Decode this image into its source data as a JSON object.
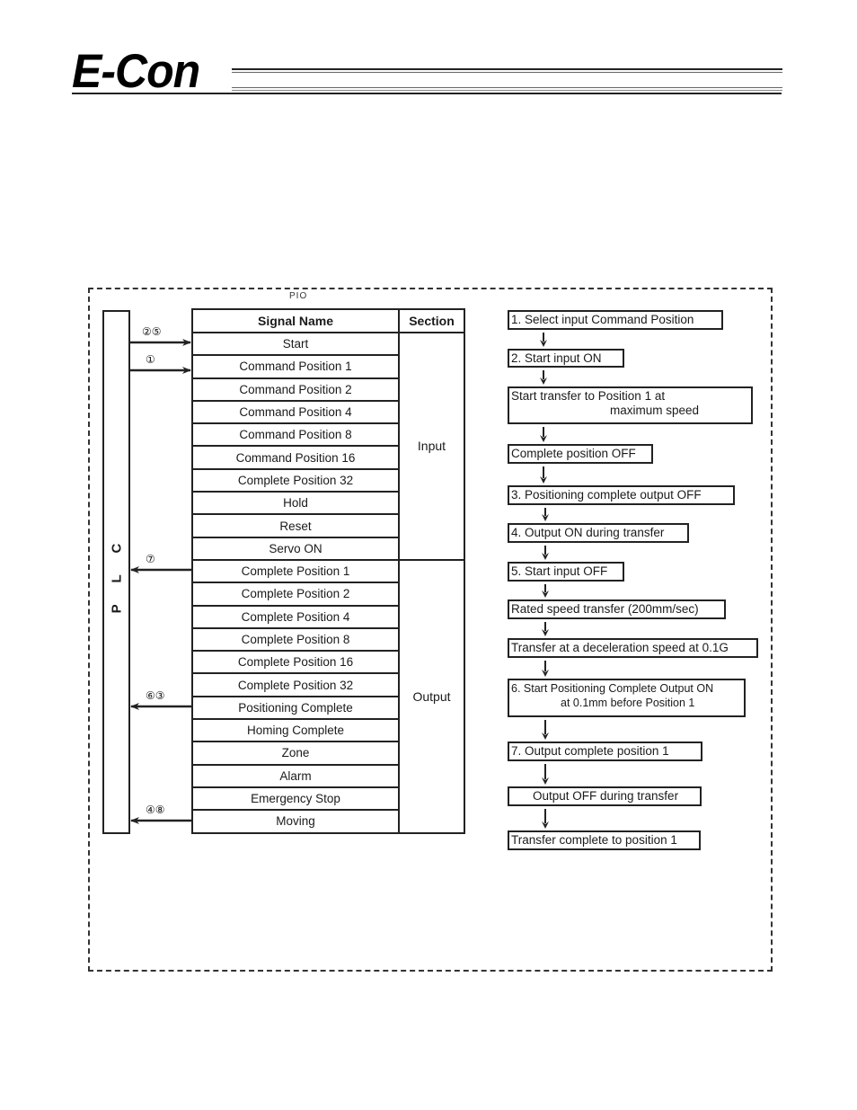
{
  "header": {
    "logo_text": "E-Con"
  },
  "diagram": {
    "pio_label": "PIO",
    "plc_label": "P L C",
    "table": {
      "headers": {
        "signal_name": "Signal Name",
        "section": "Section"
      },
      "input_section_label": "Input",
      "output_section_label": "Output",
      "input_signals": [
        "Start",
        "Command Position 1",
        "Command Position 2",
        "Command Position 4",
        "Command Position 8",
        "Command Position 16",
        "Complete Position 32",
        "Hold",
        "Reset",
        "Servo ON"
      ],
      "output_signals": [
        "Complete Position 1",
        "Complete Position 2",
        "Complete Position 4",
        "Complete Position 8",
        "Complete Position 16",
        "Complete Position 32",
        "Positioning Complete",
        "Homing Complete",
        "Zone",
        "Alarm",
        "Emergency Stop",
        "Moving"
      ]
    },
    "connections": [
      {
        "label": "②⑤",
        "signal": "Start",
        "direction": "to-pio"
      },
      {
        "label": "①",
        "signal": "Command Position 1",
        "direction": "to-pio"
      },
      {
        "label": "⑦",
        "signal": "Complete Position 1",
        "direction": "to-plc"
      },
      {
        "label": "⑥③",
        "signal": "Positioning Complete",
        "direction": "to-plc"
      },
      {
        "label": "④⑧",
        "signal": "Moving",
        "direction": "to-plc"
      }
    ],
    "flow_steps": [
      {
        "line1": "1. Select input Command Position",
        "line2": ""
      },
      {
        "line1": "2. Start input ON",
        "line2": ""
      },
      {
        "line1": "Start transfer to Position 1 at",
        "line2": "maximum speed"
      },
      {
        "line1": "Complete position OFF",
        "line2": ""
      },
      {
        "line1": "3. Positioning complete output OFF",
        "line2": ""
      },
      {
        "line1": "4. Output ON during transfer",
        "line2": ""
      },
      {
        "line1": "5. Start input OFF",
        "line2": ""
      },
      {
        "line1": "Rated speed transfer (200mm/sec)",
        "line2": ""
      },
      {
        "line1": "Transfer at a deceleration speed at 0.1G",
        "line2": ""
      },
      {
        "line1": "6. Start Positioning Complete Output ON",
        "line2": "at 0.1mm before Position 1"
      },
      {
        "line1": "7. Output complete position 1",
        "line2": ""
      },
      {
        "line1": "Output OFF during transfer",
        "line2": ""
      },
      {
        "line1": "Transfer complete to position 1",
        "line2": ""
      }
    ]
  }
}
